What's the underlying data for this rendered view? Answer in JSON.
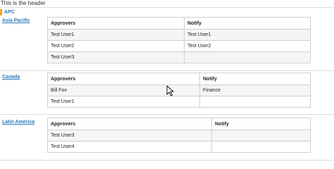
{
  "header": {
    "title": "This is the header"
  },
  "group": {
    "label": "APC",
    "accent_color": "#f5a623"
  },
  "regions": [
    {
      "name": "Asia Pacific",
      "columns": [
        "Approvers",
        "Notify"
      ],
      "rows": [
        [
          "Test User1",
          "Test User1"
        ],
        [
          "Test User2",
          "Test User2"
        ],
        [
          "Test User3",
          ""
        ]
      ]
    },
    {
      "name": "Canada",
      "columns": [
        "Approvers",
        "Notify"
      ],
      "rows": [
        [
          "Bill Fox",
          "Finance"
        ],
        [
          "Test User1",
          ""
        ]
      ]
    },
    {
      "name": "Latin America",
      "columns": [
        "Approvers",
        "Notify"
      ],
      "rows": [
        [
          "Test User3",
          ""
        ],
        [
          "Test User4",
          ""
        ]
      ]
    }
  ],
  "colors": {
    "link": "#2a7ab9",
    "border": "#cfcfcf",
    "row_alt": "#f5f5f5"
  }
}
